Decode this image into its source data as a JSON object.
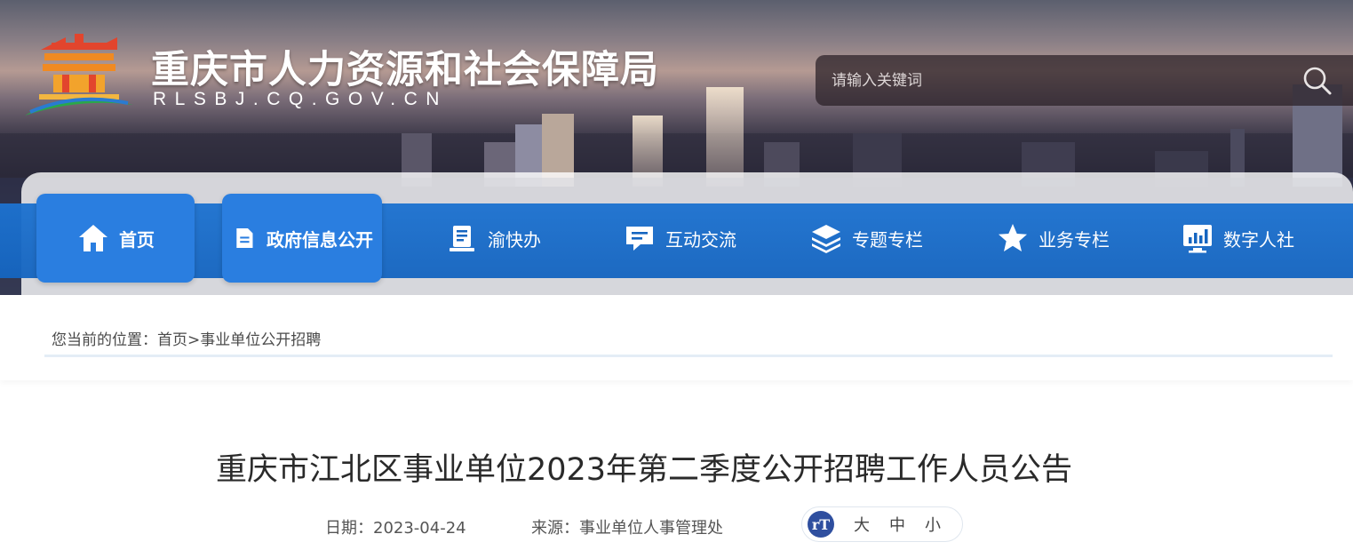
{
  "header": {
    "site_title": "重庆市人力资源和社会保障局",
    "site_domain": "RLSBJ.CQ.GOV.CN"
  },
  "search": {
    "placeholder": "请输入关键词",
    "icon": "search-icon"
  },
  "nav": {
    "items": [
      {
        "label": "首页",
        "icon": "home-icon"
      },
      {
        "label": "政府信息公开",
        "icon": "document-icon"
      },
      {
        "label": "渝快办",
        "icon": "service-icon"
      },
      {
        "label": "互动交流",
        "icon": "chat-icon"
      },
      {
        "label": "专题专栏",
        "icon": "layers-icon"
      },
      {
        "label": "业务专栏",
        "icon": "star-icon"
      },
      {
        "label": "数字人社",
        "icon": "monitor-chart-icon"
      }
    ]
  },
  "breadcrumb": {
    "prefix": "您当前的位置：",
    "home": "首页",
    "separator": ">",
    "current": "事业单位公开招聘"
  },
  "article": {
    "title": "重庆市江北区事业单位2023年第二季度公开招聘工作人员公告",
    "date_label": "日期：",
    "date": "2023-04-24",
    "source_label": "来源：",
    "source": "事业单位人事管理处",
    "font_size": {
      "icon_text": "rT",
      "large": "大",
      "medium": "中",
      "small": "小"
    }
  },
  "colors": {
    "nav_blue": "#1565c0",
    "nav_tile_blue": "#2a7ee0",
    "font_icon_blue": "#2f4f9f"
  }
}
